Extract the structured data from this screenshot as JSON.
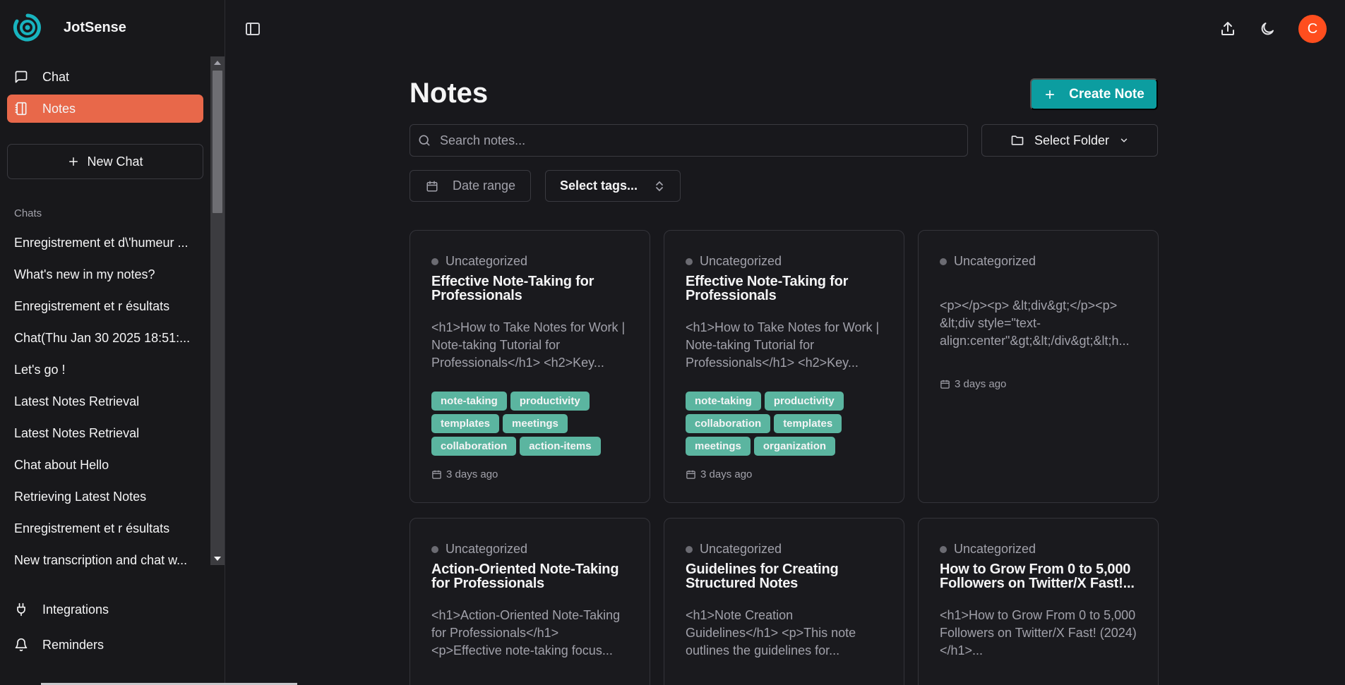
{
  "app": {
    "name": "JotSense"
  },
  "nav": [
    {
      "label": "Chat",
      "icon": "message-square-icon",
      "active": false
    },
    {
      "label": "Notes",
      "icon": "notebook-icon",
      "active": true
    }
  ],
  "new_chat_label": "New Chat",
  "chats_heading": "Chats",
  "chats": [
    "Enregistrement et d\\'humeur ...",
    "What's new in my notes?",
    "Enregistrement et r ésultats",
    "Chat(Thu Jan 30 2025 18:51:...",
    "Let's go !",
    "Latest Notes Retrieval",
    "Latest Notes Retrieval",
    "Chat about Hello",
    "Retrieving Latest Notes",
    "Enregistrement et r ésultats",
    "New transcription and chat w..."
  ],
  "bottom_nav": [
    {
      "label": "Integrations",
      "icon": "plug-icon"
    },
    {
      "label": "Reminders",
      "icon": "bell-icon"
    }
  ],
  "user": {
    "initial": "C",
    "avatar_color": "#ff4e1e"
  },
  "page": {
    "title": "Notes",
    "create_label": "Create Note",
    "search_placeholder": "Search notes...",
    "folder_label": "Select Folder",
    "date_range_label": "Date range",
    "tags_label": "Select tags..."
  },
  "colors": {
    "accent_nav": "#e8684a",
    "primary_button": "#0c9da0",
    "tag": "#5bb5a0",
    "background": "#18181c"
  },
  "notes": [
    {
      "category": "Uncategorized",
      "title": "Effective Note-Taking for Professionals",
      "excerpt": "<h1>How to Take Notes for Work | Note-taking Tutorial for Professionals</h1> <h2>Key...",
      "tags": [
        "note-taking",
        "productivity",
        "templates",
        "meetings",
        "collaboration",
        "action-items"
      ],
      "date": "3 days ago"
    },
    {
      "category": "Uncategorized",
      "title": "Effective Note-Taking for Professionals",
      "excerpt": "<h1>How to Take Notes for Work | Note-taking Tutorial for Professionals</h1> <h2>Key...",
      "tags": [
        "note-taking",
        "productivity",
        "collaboration",
        "templates",
        "meetings",
        "organization"
      ],
      "date": "3 days ago"
    },
    {
      "category": "Uncategorized",
      "title": "",
      "excerpt": "<p></p><p> &lt;div&gt;</p><p> &lt;div style=\"text-align:center\"&gt;&lt;/div&gt;&lt;h...",
      "tags": [],
      "date": "3 days ago"
    },
    {
      "category": "Uncategorized",
      "title": "Action-Oriented Note-Taking for Professionals",
      "excerpt": "<h1>Action-Oriented Note-Taking for Professionals</h1> <p>Effective note-taking focus...",
      "tags": [],
      "date": ""
    },
    {
      "category": "Uncategorized",
      "title": "Guidelines for Creating Structured Notes",
      "excerpt": "<h1>Note Creation Guidelines</h1> <p>This note outlines the guidelines for...",
      "tags": [],
      "date": ""
    },
    {
      "category": "Uncategorized",
      "title": "How to Grow From 0 to 5,000 Followers on Twitter/X Fast!...",
      "excerpt": "<h1>How to Grow From 0 to 5,000 Followers on Twitter/X Fast! (2024)</h1>...",
      "tags": [],
      "date": ""
    }
  ]
}
